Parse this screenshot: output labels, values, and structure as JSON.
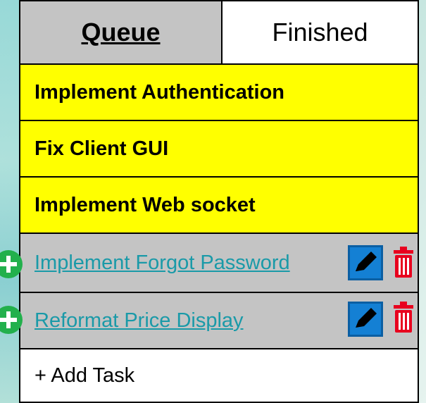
{
  "tabs": {
    "queue_label": "Queue",
    "finished_label": "Finished",
    "active": "Queue"
  },
  "tasks": [
    {
      "title": "Implement Authentication"
    },
    {
      "title": "Fix Client GUI"
    },
    {
      "title": "Implement Web socket"
    }
  ],
  "linked_tasks": [
    {
      "title": "Implement Forgot Password",
      "actions": [
        "edit-icon",
        "trash-icon",
        "plus-icon"
      ]
    },
    {
      "title": "Reformat Price Display",
      "actions": [
        "edit-icon",
        "trash-icon",
        "plus-icon"
      ]
    }
  ],
  "add_task_label": "+ Add Task",
  "colors": {
    "active_tab": "#c4c4c4",
    "highlight_row": "#ffff00",
    "link_row": "#c4c4c4",
    "link_text": "#1a9aa8",
    "edit_icon": "#1480d4",
    "trash_icon": "#e8001e",
    "plus_icon": "#22b04c"
  }
}
